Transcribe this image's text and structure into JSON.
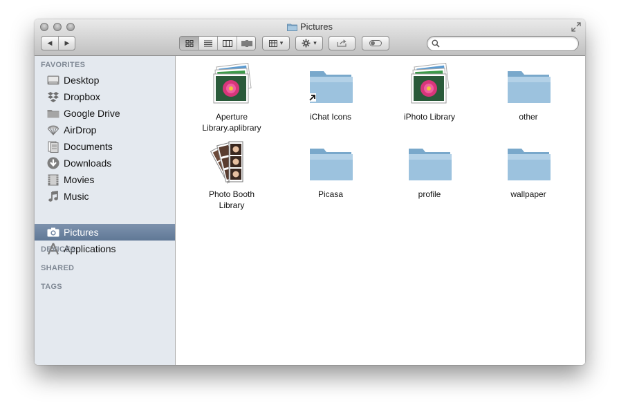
{
  "window": {
    "title": "Pictures",
    "title_icon": "folder-icon"
  },
  "toolbar": {
    "back_glyph": "◀",
    "forward_glyph": "▶",
    "view_modes": [
      "icon-view-icon",
      "list-view-icon",
      "column-view-icon",
      "coverflow-view-icon"
    ],
    "active_view": "icon-view-icon",
    "arrange_icon": "arrange-icon",
    "action_icon": "gear-icon",
    "share_icon": "share-icon",
    "tags_icon": "tag-toggle-icon",
    "dropdown_glyph": "▾"
  },
  "search": {
    "placeholder": "",
    "value": ""
  },
  "sidebar": {
    "favorites_label": "FAVORITES",
    "devices_label": "DEVICES",
    "shared_label": "SHARED",
    "tags_label": "TAGS",
    "items": [
      {
        "label": "Desktop",
        "icon": "desktop-icon"
      },
      {
        "label": "Dropbox",
        "icon": "dropbox-icon"
      },
      {
        "label": "Google Drive",
        "icon": "folder-icon"
      },
      {
        "label": "AirDrop",
        "icon": "airdrop-icon"
      },
      {
        "label": "Documents",
        "icon": "documents-icon"
      },
      {
        "label": "Downloads",
        "icon": "downloads-icon"
      },
      {
        "label": "Movies",
        "icon": "movies-icon"
      },
      {
        "label": "Music",
        "icon": "music-icon"
      },
      {
        "label": "Pictures",
        "icon": "camera-icon",
        "selected": true
      },
      {
        "label": "Applications",
        "icon": "applications-icon"
      }
    ]
  },
  "files": [
    {
      "name": "Aperture Library.aplibrary",
      "line1": "Aperture",
      "line2": "Library.aplibrary",
      "type": "photo-library"
    },
    {
      "name": "iChat Icons",
      "line1": "iChat Icons",
      "line2": "",
      "type": "folder-alias"
    },
    {
      "name": "iPhoto Library",
      "line1": "iPhoto Library",
      "line2": "",
      "type": "photo-library"
    },
    {
      "name": "other",
      "line1": "other",
      "line2": "",
      "type": "folder"
    },
    {
      "name": "Photo Booth Library",
      "line1": "Photo Booth",
      "line2": "Library",
      "type": "photo-booth"
    },
    {
      "name": "Picasa",
      "line1": "Picasa",
      "line2": "",
      "type": "folder"
    },
    {
      "name": "profile",
      "line1": "profile",
      "line2": "",
      "type": "folder"
    },
    {
      "name": "wallpaper",
      "line1": "wallpaper",
      "line2": "",
      "type": "folder"
    }
  ],
  "colors": {
    "sidebar_bg": "#e4e9ef",
    "selection": "#6f86a3",
    "folder_blue": "#8fb6d3"
  }
}
